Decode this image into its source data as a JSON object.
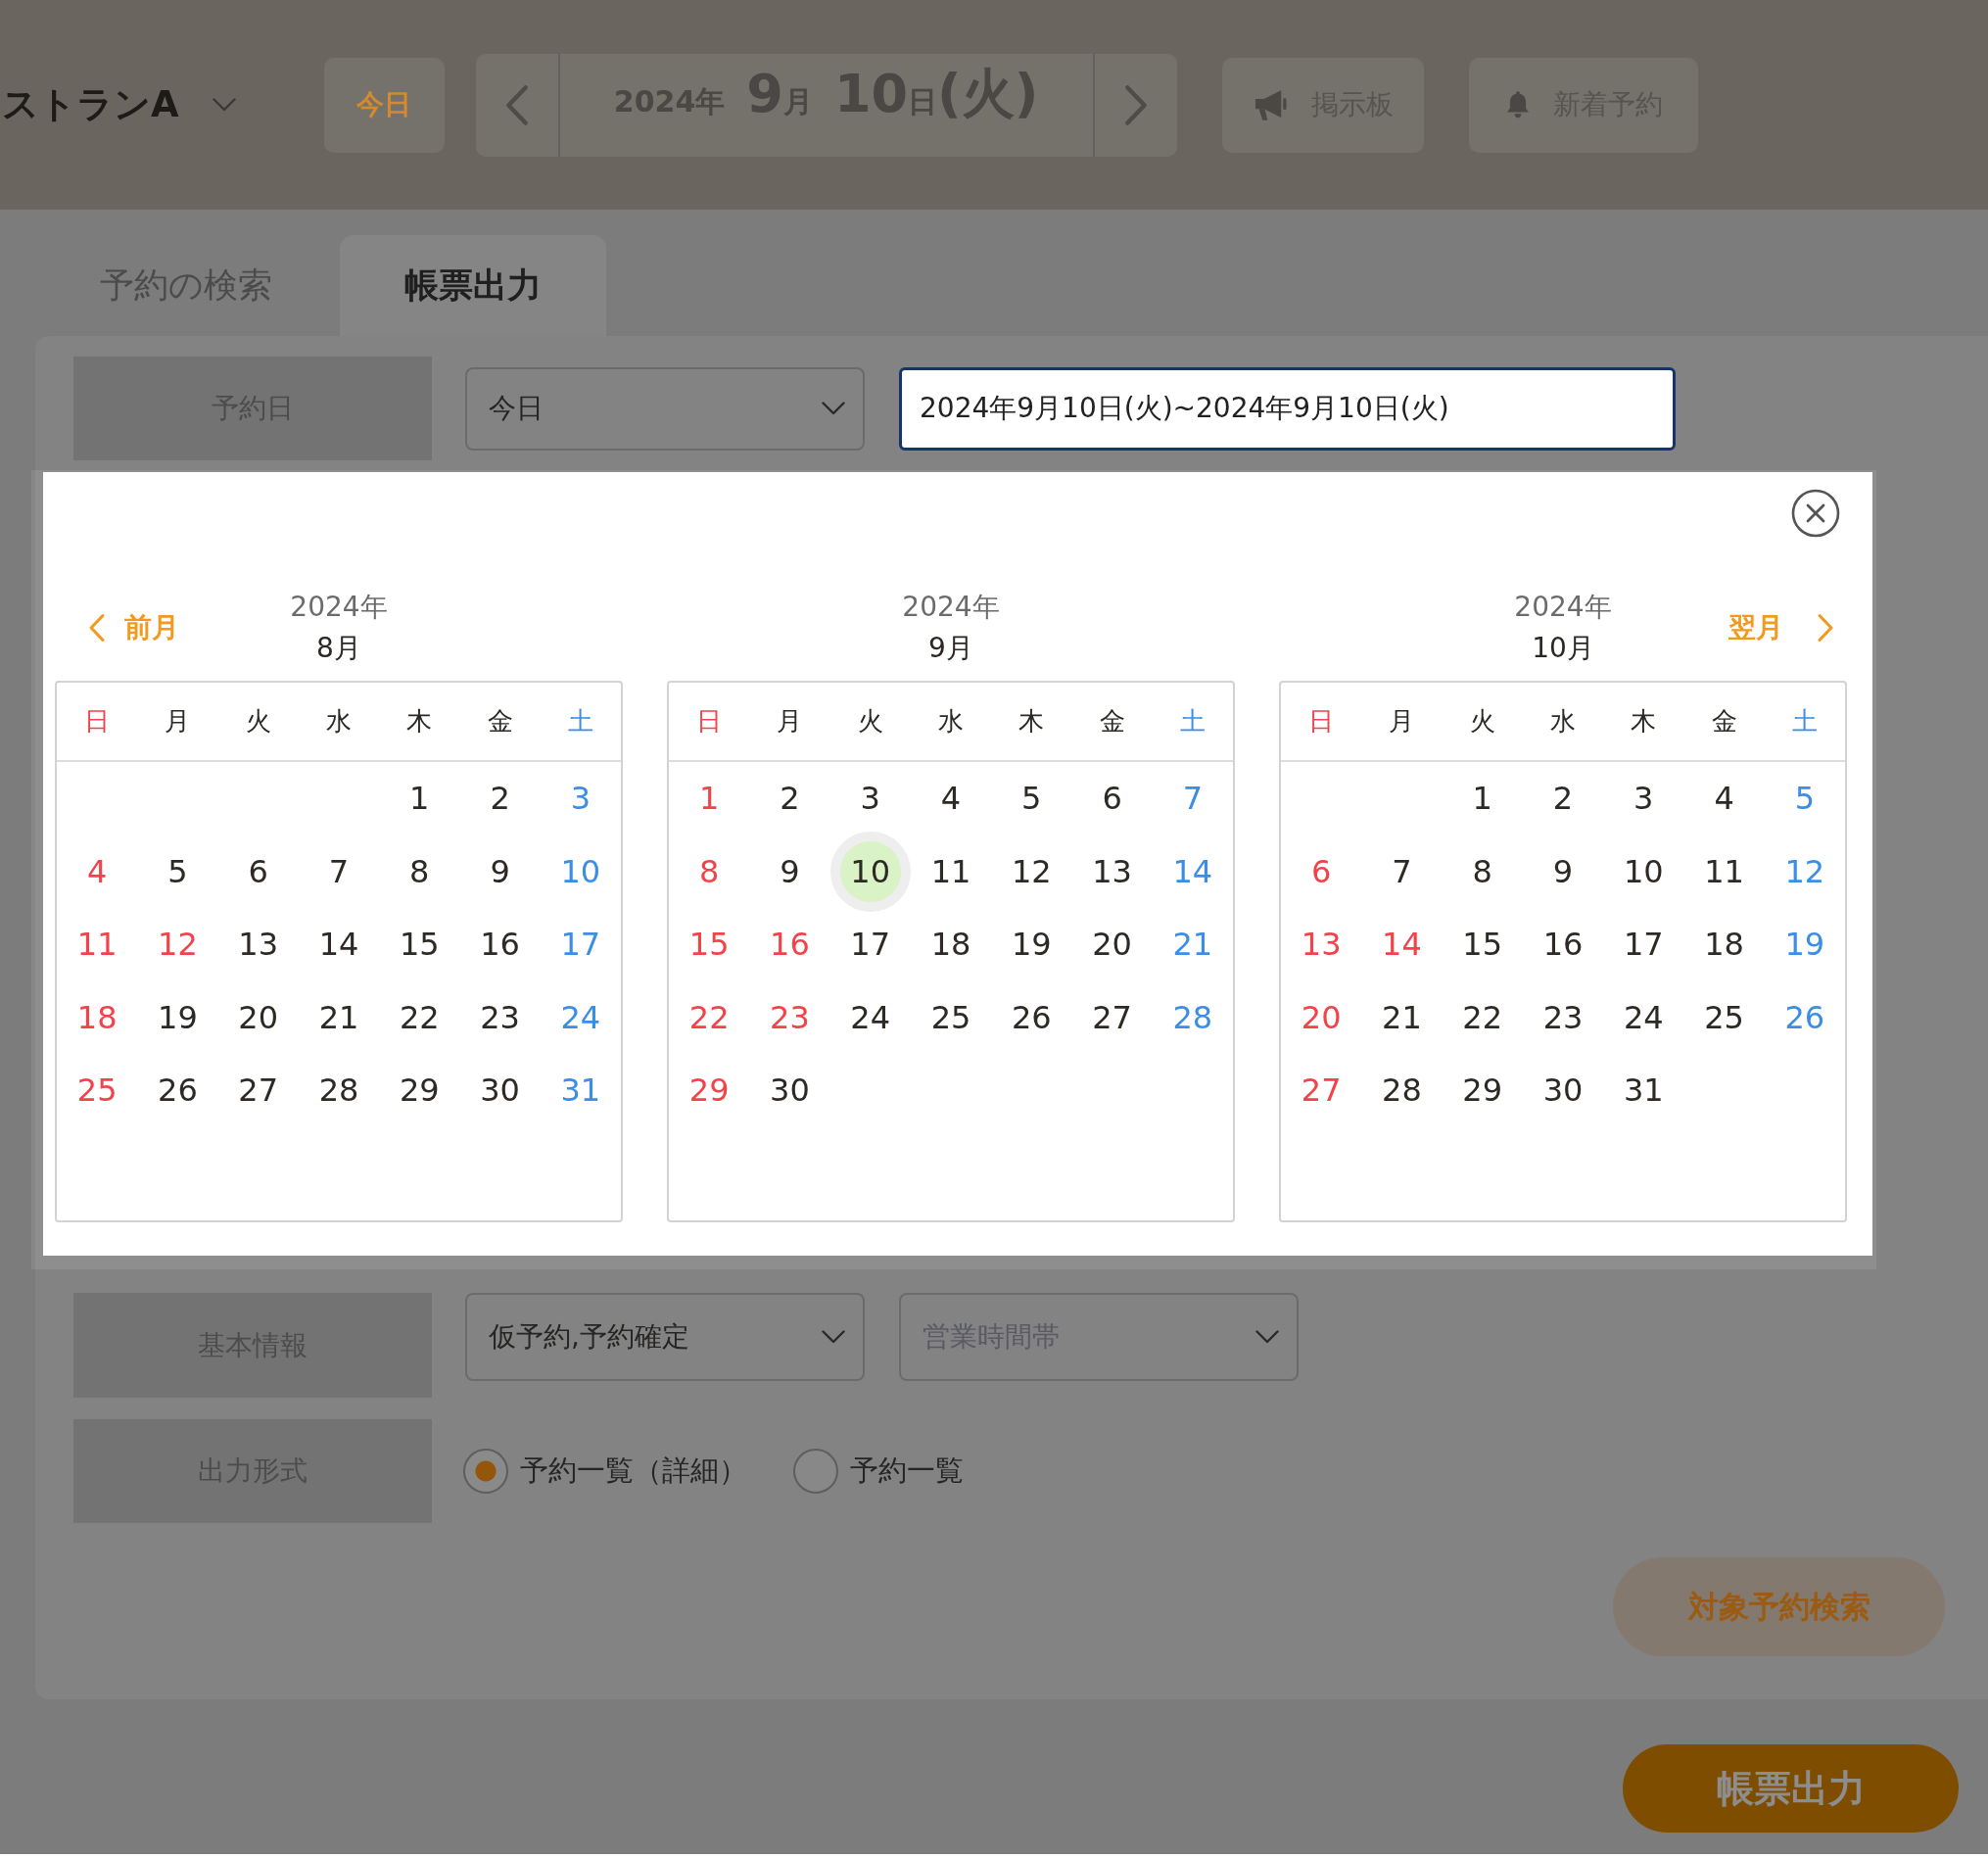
{
  "header": {
    "store_name": "ストランA",
    "today_button": "今日",
    "date": [
      {
        "number": "2024",
        "unit": "年",
        "kind": "year"
      },
      {
        "number": "9",
        "unit": "月",
        "kind": "month"
      },
      {
        "number": "10",
        "unit": "日",
        "kind": "day"
      }
    ],
    "weekday": "(火)",
    "bulletin_button": "掲示板",
    "new_reservations_button": "新着予約"
  },
  "tabs": [
    {
      "label": "予約の検索",
      "selected": false
    },
    {
      "label": "帳票出力",
      "selected": true
    }
  ],
  "form": {
    "reservation_date": {
      "label": "予約日",
      "period_select": {
        "value": "今日"
      },
      "range": {
        "value": "2024年9月10日(火)~2024年9月10日(火)"
      }
    },
    "basic_info": {
      "label": "基本情報",
      "status_select": {
        "value": "仮予約,予約確定"
      },
      "hours_select": {
        "placeholder": "営業時間帯"
      }
    },
    "output_format": {
      "label": "出力形式",
      "options": [
        {
          "label": "予約一覧（詳細）",
          "selected": true
        },
        {
          "label": "予約一覧",
          "selected": false
        }
      ]
    }
  },
  "date_picker": {
    "prev_label": "前月",
    "next_label": "翌月",
    "months": [
      {
        "year": "2024年",
        "month": "8月",
        "weekdays": [
          {
            "label": "日",
            "kind": "sunday"
          },
          {
            "label": "月",
            "kind": "weekday"
          },
          {
            "label": "火",
            "kind": "weekday"
          },
          {
            "label": "水",
            "kind": "weekday"
          },
          {
            "label": "木",
            "kind": "weekday"
          },
          {
            "label": "金",
            "kind": "weekday"
          },
          {
            "label": "土",
            "kind": "saturday"
          }
        ],
        "weeks": [
          [
            {
              "day": "1",
              "kind": "weekday",
              "selected": false
            },
            {
              "day": "2",
              "kind": "weekday",
              "selected": false
            },
            {
              "day": "3",
              "kind": "saturday",
              "selected": false
            }
          ],
          [
            {
              "day": "4",
              "kind": "sunday",
              "selected": false
            },
            {
              "day": "5",
              "kind": "weekday",
              "selected": false
            },
            {
              "day": "6",
              "kind": "weekday",
              "selected": false
            },
            {
              "day": "7",
              "kind": "weekday",
              "selected": false
            },
            {
              "day": "8",
              "kind": "weekday",
              "selected": false
            },
            {
              "day": "9",
              "kind": "weekday",
              "selected": false
            },
            {
              "day": "10",
              "kind": "saturday",
              "selected": false
            }
          ],
          [
            {
              "day": "11",
              "kind": "sunday",
              "selected": false
            },
            {
              "day": "12",
              "kind": "holiday",
              "selected": false
            },
            {
              "day": "13",
              "kind": "weekday",
              "selected": false
            },
            {
              "day": "14",
              "kind": "weekday",
              "selected": false
            },
            {
              "day": "15",
              "kind": "weekday",
              "selected": false
            },
            {
              "day": "16",
              "kind": "weekday",
              "selected": false
            },
            {
              "day": "17",
              "kind": "saturday",
              "selected": false
            }
          ],
          [
            {
              "day": "18",
              "kind": "sunday",
              "selected": false
            },
            {
              "day": "19",
              "kind": "weekday",
              "selected": false
            },
            {
              "day": "20",
              "kind": "weekday",
              "selected": false
            },
            {
              "day": "21",
              "kind": "weekday",
              "selected": false
            },
            {
              "day": "22",
              "kind": "weekday",
              "selected": false
            },
            {
              "day": "23",
              "kind": "weekday",
              "selected": false
            },
            {
              "day": "24",
              "kind": "saturday",
              "selected": false
            }
          ],
          [
            {
              "day": "25",
              "kind": "sunday",
              "selected": false
            },
            {
              "day": "26",
              "kind": "weekday",
              "selected": false
            },
            {
              "day": "27",
              "kind": "weekday",
              "selected": false
            },
            {
              "day": "28",
              "kind": "weekday",
              "selected": false
            },
            {
              "day": "29",
              "kind": "weekday",
              "selected": false
            },
            {
              "day": "30",
              "kind": "weekday",
              "selected": false
            },
            {
              "day": "31",
              "kind": "saturday",
              "selected": false
            }
          ]
        ]
      },
      {
        "year": "2024年",
        "month": "9月",
        "weekdays": [
          {
            "label": "日",
            "kind": "sunday"
          },
          {
            "label": "月",
            "kind": "weekday"
          },
          {
            "label": "火",
            "kind": "weekday"
          },
          {
            "label": "水",
            "kind": "weekday"
          },
          {
            "label": "木",
            "kind": "weekday"
          },
          {
            "label": "金",
            "kind": "weekday"
          },
          {
            "label": "土",
            "kind": "saturday"
          }
        ],
        "weeks": [
          [
            {
              "day": "1",
              "kind": "sunday",
              "selected": false
            },
            {
              "day": "2",
              "kind": "weekday",
              "selected": false
            },
            {
              "day": "3",
              "kind": "weekday",
              "selected": false
            },
            {
              "day": "4",
              "kind": "weekday",
              "selected": false
            },
            {
              "day": "5",
              "kind": "weekday",
              "selected": false
            },
            {
              "day": "6",
              "kind": "weekday",
              "selected": false
            },
            {
              "day": "7",
              "kind": "saturday",
              "selected": false
            }
          ],
          [
            {
              "day": "8",
              "kind": "sunday",
              "selected": false
            },
            {
              "day": "9",
              "kind": "weekday",
              "selected": false
            },
            {
              "day": "10",
              "kind": "weekday",
              "selected": true
            },
            {
              "day": "11",
              "kind": "weekday",
              "selected": false
            },
            {
              "day": "12",
              "kind": "weekday",
              "selected": false
            },
            {
              "day": "13",
              "kind": "weekday",
              "selected": false
            },
            {
              "day": "14",
              "kind": "saturday",
              "selected": false
            }
          ],
          [
            {
              "day": "15",
              "kind": "sunday",
              "selected": false
            },
            {
              "day": "16",
              "kind": "holiday",
              "selected": false
            },
            {
              "day": "17",
              "kind": "weekday",
              "selected": false
            },
            {
              "day": "18",
              "kind": "weekday",
              "selected": false
            },
            {
              "day": "19",
              "kind": "weekday",
              "selected": false
            },
            {
              "day": "20",
              "kind": "weekday",
              "selected": false
            },
            {
              "day": "21",
              "kind": "saturday",
              "selected": false
            }
          ],
          [
            {
              "day": "22",
              "kind": "sunday",
              "selected": false
            },
            {
              "day": "23",
              "kind": "holiday",
              "selected": false
            },
            {
              "day": "24",
              "kind": "weekday",
              "selected": false
            },
            {
              "day": "25",
              "kind": "weekday",
              "selected": false
            },
            {
              "day": "26",
              "kind": "weekday",
              "selected": false
            },
            {
              "day": "27",
              "kind": "weekday",
              "selected": false
            },
            {
              "day": "28",
              "kind": "saturday",
              "selected": false
            }
          ],
          [
            {
              "day": "29",
              "kind": "sunday",
              "selected": false
            },
            {
              "day": "30",
              "kind": "weekday",
              "selected": false
            }
          ]
        ]
      },
      {
        "year": "2024年",
        "month": "10月",
        "weekdays": [
          {
            "label": "日",
            "kind": "sunday"
          },
          {
            "label": "月",
            "kind": "weekday"
          },
          {
            "label": "火",
            "kind": "weekday"
          },
          {
            "label": "水",
            "kind": "weekday"
          },
          {
            "label": "木",
            "kind": "weekday"
          },
          {
            "label": "金",
            "kind": "weekday"
          },
          {
            "label": "土",
            "kind": "saturday"
          }
        ],
        "weeks": [
          [
            {
              "day": "1",
              "kind": "weekday",
              "selected": false
            },
            {
              "day": "2",
              "kind": "weekday",
              "selected": false
            },
            {
              "day": "3",
              "kind": "weekday",
              "selected": false
            },
            {
              "day": "4",
              "kind": "weekday",
              "selected": false
            },
            {
              "day": "5",
              "kind": "saturday",
              "selected": false
            }
          ],
          [
            {
              "day": "6",
              "kind": "sunday",
              "selected": false
            },
            {
              "day": "7",
              "kind": "weekday",
              "selected": false
            },
            {
              "day": "8",
              "kind": "weekday",
              "selected": false
            },
            {
              "day": "9",
              "kind": "weekday",
              "selected": false
            },
            {
              "day": "10",
              "kind": "weekday",
              "selected": false
            },
            {
              "day": "11",
              "kind": "weekday",
              "selected": false
            },
            {
              "day": "12",
              "kind": "saturday",
              "selected": false
            }
          ],
          [
            {
              "day": "13",
              "kind": "sunday",
              "selected": false
            },
            {
              "day": "14",
              "kind": "holiday",
              "selected": false
            },
            {
              "day": "15",
              "kind": "weekday",
              "selected": false
            },
            {
              "day": "16",
              "kind": "weekday",
              "selected": false
            },
            {
              "day": "17",
              "kind": "weekday",
              "selected": false
            },
            {
              "day": "18",
              "kind": "weekday",
              "selected": false
            },
            {
              "day": "19",
              "kind": "saturday",
              "selected": false
            }
          ],
          [
            {
              "day": "20",
              "kind": "sunday",
              "selected": false
            },
            {
              "day": "21",
              "kind": "weekday",
              "selected": false
            },
            {
              "day": "22",
              "kind": "weekday",
              "selected": false
            },
            {
              "day": "23",
              "kind": "weekday",
              "selected": false
            },
            {
              "day": "24",
              "kind": "weekday",
              "selected": false
            },
            {
              "day": "25",
              "kind": "weekday",
              "selected": false
            },
            {
              "day": "26",
              "kind": "saturday",
              "selected": false
            }
          ],
          [
            {
              "day": "27",
              "kind": "sunday",
              "selected": false
            },
            {
              "day": "28",
              "kind": "weekday",
              "selected": false
            },
            {
              "day": "29",
              "kind": "weekday",
              "selected": false
            },
            {
              "day": "30",
              "kind": "weekday",
              "selected": false
            },
            {
              "day": "31",
              "kind": "weekday",
              "selected": false
            }
          ]
        ]
      }
    ]
  },
  "actions": {
    "search_button": "対象予約検索",
    "export_button": "帳票出力"
  }
}
